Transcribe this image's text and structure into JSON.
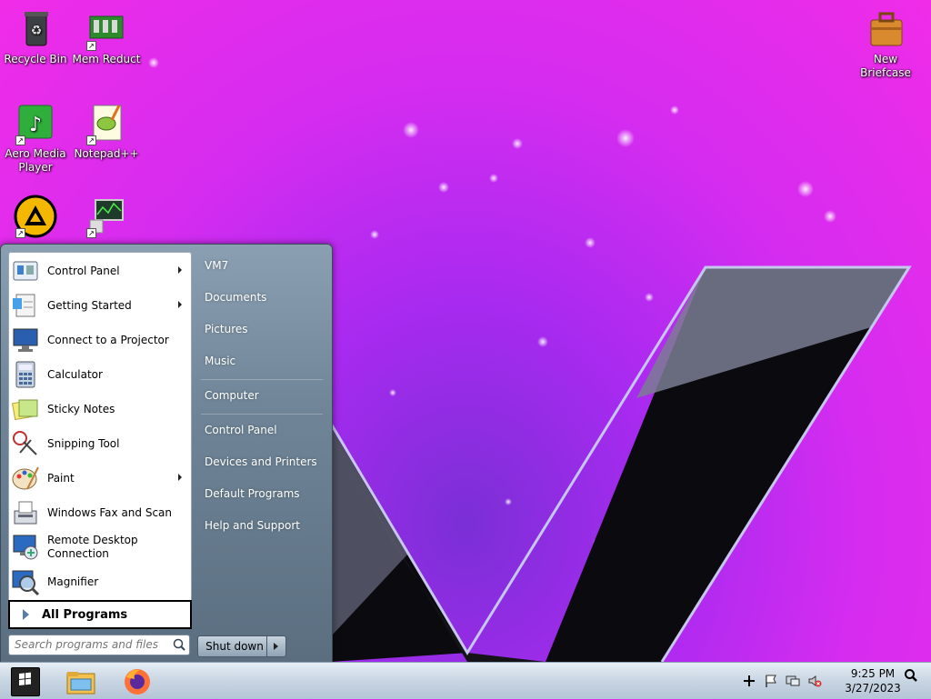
{
  "desktop": {
    "icons": [
      {
        "label": "Recycle Bin",
        "icon": "recycle-bin-icon"
      },
      {
        "label": "Mem Reduct",
        "icon": "memory-chip-icon"
      },
      {
        "label": "New Briefcase",
        "icon": "briefcase-icon"
      },
      {
        "label": "Aero Media Player",
        "icon": "music-note-icon"
      },
      {
        "label": "Notepad++",
        "icon": "notepad-plus-icon"
      },
      {
        "label": "",
        "icon": "aimp-icon"
      },
      {
        "label": "",
        "icon": "monitor-chart-icon"
      }
    ]
  },
  "start_menu": {
    "programs": [
      {
        "label": "Control Panel",
        "icon": "control-panel-icon",
        "submenu": true
      },
      {
        "label": "Getting Started",
        "icon": "getting-started-icon",
        "submenu": true
      },
      {
        "label": "Connect to a Projector",
        "icon": "projector-icon",
        "submenu": false
      },
      {
        "label": "Calculator",
        "icon": "calculator-icon",
        "submenu": false
      },
      {
        "label": "Sticky Notes",
        "icon": "sticky-notes-icon",
        "submenu": false
      },
      {
        "label": "Snipping Tool",
        "icon": "scissors-icon",
        "submenu": false
      },
      {
        "label": "Paint",
        "icon": "paint-palette-icon",
        "submenu": true
      },
      {
        "label": "Windows Fax and Scan",
        "icon": "fax-icon",
        "submenu": false
      },
      {
        "label": "Remote Desktop Connection",
        "icon": "remote-desktop-icon",
        "submenu": false
      },
      {
        "label": "Magnifier",
        "icon": "magnifier-icon",
        "submenu": false
      }
    ],
    "all_programs": "All Programs",
    "search_placeholder": "Search programs and files",
    "right_items": [
      "VM7",
      "Documents",
      "Pictures",
      "Music",
      "Computer",
      "Control Panel",
      "Devices and Printers",
      "Default Programs",
      "Help and Support"
    ],
    "shutdown_label": "Shut down"
  },
  "taskbar": {
    "time": "9:25 PM",
    "date": "3/27/2023",
    "pinned": [
      "file-explorer-icon",
      "firefox-icon"
    ],
    "tray": [
      "plus-icon",
      "action-center-flag-icon",
      "network-icon",
      "volume-muted-icon",
      "search-icon"
    ]
  },
  "colors": {
    "wallpaper_magenta": "#f02ce8",
    "wallpaper_purple": "#7a2fd6",
    "start_menu_right": "#6f8597",
    "taskbar": "#c8d5e3"
  }
}
